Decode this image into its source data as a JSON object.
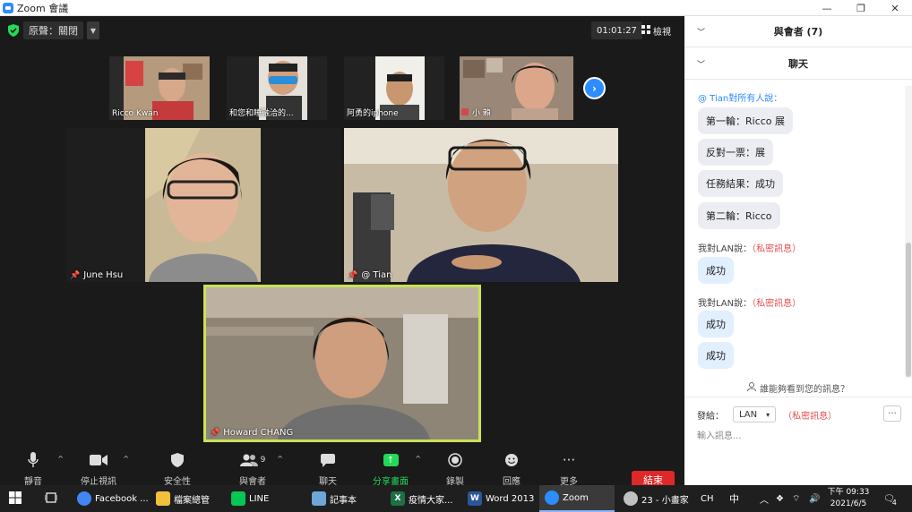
{
  "window": {
    "title": "Zoom 會議",
    "controls": [
      "—",
      "❐",
      "✕"
    ]
  },
  "meeting_top": {
    "language": "原聲：關閉",
    "timer": "01:01:27",
    "view_label": "檢視"
  },
  "thumbnails": [
    {
      "name": "Ricco Kwan"
    },
    {
      "name": "和您和睡融洽的..."
    },
    {
      "name": "阿勇的iphone"
    },
    {
      "name": "小 賴"
    }
  ],
  "tiles": [
    {
      "name": "June Hsu"
    },
    {
      "name": "@ Tian"
    },
    {
      "name": "Howard CHANG"
    }
  ],
  "toolbar": {
    "mute": "靜音",
    "stop_video": "停止視訊",
    "security": "安全性",
    "participants": "與會者",
    "participants_count": "9",
    "chat": "聊天",
    "share": "分享畫面",
    "record": "錄製",
    "reactions": "回應",
    "more": "更多",
    "end": "結束"
  },
  "panel": {
    "participants_header": "與會者 (7)",
    "chat_header": "聊天",
    "messages": [
      {
        "sender": "@ Tian對所有人說：",
        "bubbles": [
          "第一輪：Ricco 展",
          "反對一票：展",
          "任務結果：成功",
          "第二輪：Ricco"
        ]
      },
      {
        "sender_prefix": "我對LAN說：",
        "sender_private": "（私密訊息）",
        "bubbles": [
          "成功"
        ]
      },
      {
        "sender_prefix": "我對LAN說：",
        "sender_private": "（私密訊息）",
        "bubbles": [
          "成功",
          "成功"
        ]
      }
    ],
    "who_can_see": "誰能夠看到您的訊息？",
    "send_to_label": "發給：",
    "send_to_value": "LAN",
    "private_tag": "（私密訊息）",
    "more_button": "···",
    "input_placeholder": "輸入訊息..."
  },
  "taskbar": {
    "items": [
      {
        "label": "Facebook ...",
        "color": "#4285f4"
      },
      {
        "label": "檔案總管",
        "color": "#f2c13b"
      },
      {
        "label": "LINE",
        "color": "#06c755"
      },
      {
        "label": "記事本",
        "color": "#6ea6d8"
      },
      {
        "label": "疫情大家...",
        "color": "#1e7145"
      },
      {
        "label": "Word 2013",
        "color": "#2b579a"
      },
      {
        "label": "Zoom",
        "color": "#2d8cff"
      },
      {
        "label": "23 - 小畫家",
        "color": "#c0c0c0"
      }
    ],
    "ime": "CH",
    "ime2": "中",
    "time": "下午 09:33",
    "date": "2021/6/5",
    "notifications": "4"
  }
}
